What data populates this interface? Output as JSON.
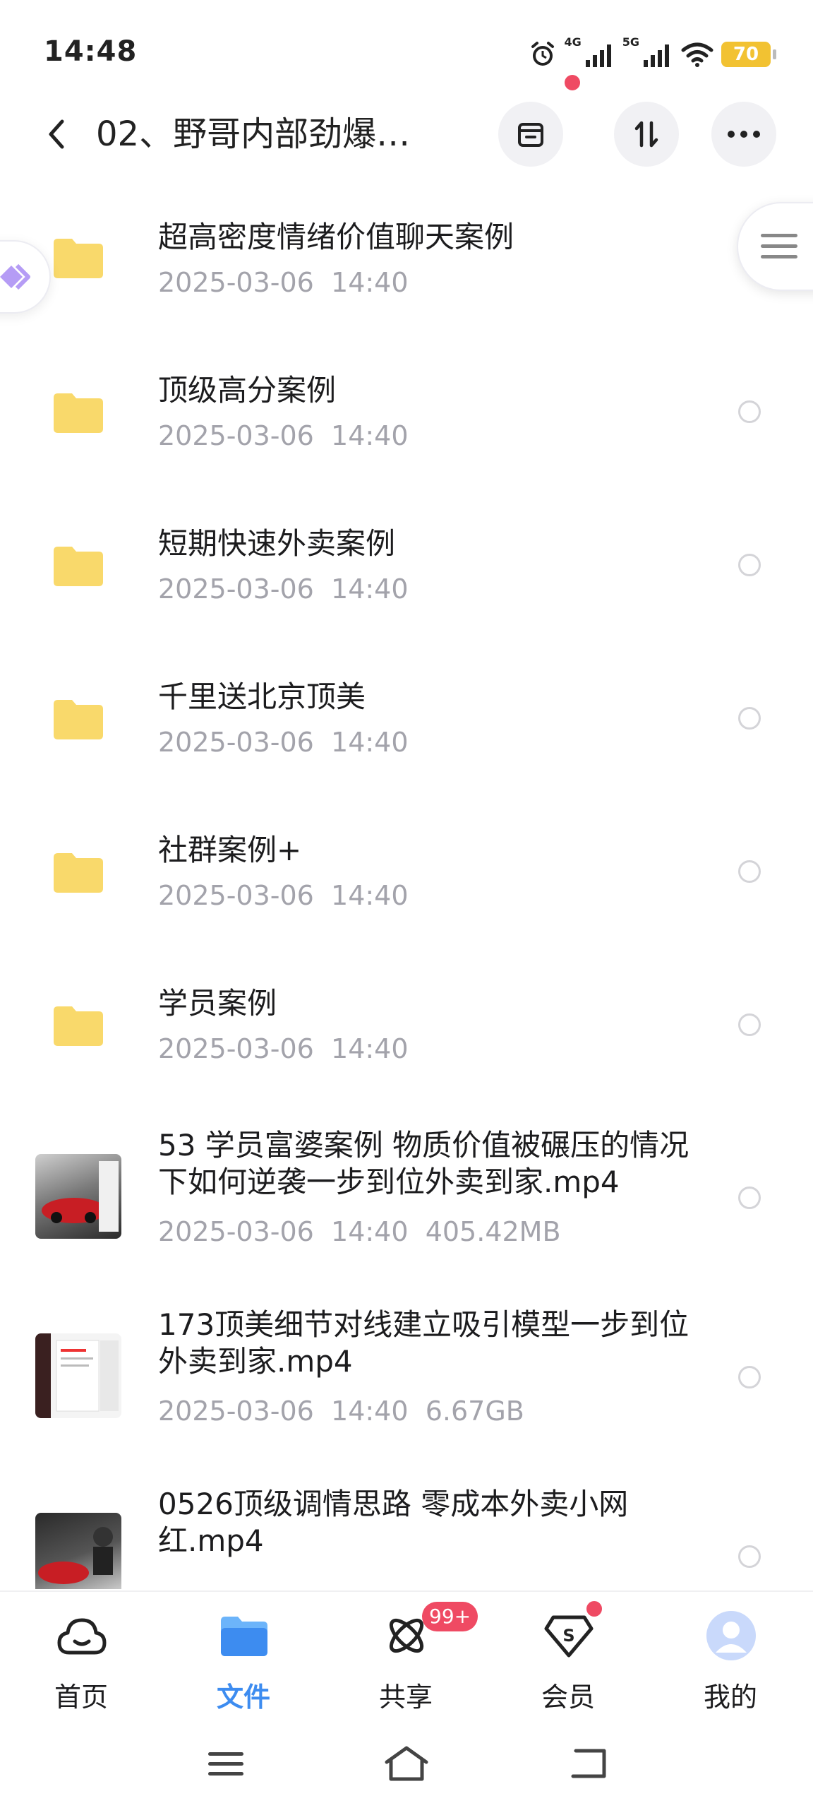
{
  "status_bar": {
    "time": "14:48",
    "network_1": "4G",
    "network_2": "5G",
    "battery": "70"
  },
  "header": {
    "title": "02、野哥内部劲爆…",
    "back_icon": "chevron-left-icon",
    "buttons": [
      "archive-icon",
      "sort-icon",
      "more-icon"
    ]
  },
  "files": [
    {
      "type": "folder",
      "name": "超高密度情绪价值聊天案例",
      "date": "2025-03-06",
      "time": "14:40",
      "size": ""
    },
    {
      "type": "folder",
      "name": "顶级高分案例",
      "date": "2025-03-06",
      "time": "14:40",
      "size": ""
    },
    {
      "type": "folder",
      "name": "短期快速外卖案例",
      "date": "2025-03-06",
      "time": "14:40",
      "size": ""
    },
    {
      "type": "folder",
      "name": "千里送北京顶美",
      "date": "2025-03-06",
      "time": "14:40",
      "size": ""
    },
    {
      "type": "folder",
      "name": "社群案例+",
      "date": "2025-03-06",
      "time": "14:40",
      "size": ""
    },
    {
      "type": "folder",
      "name": "学员案例",
      "date": "2025-03-06",
      "time": "14:40",
      "size": ""
    },
    {
      "type": "video",
      "name": "53 学员富婆案例 物质价值被碾压的情况下如何逆袭一步到位外卖到家.mp4",
      "date": "2025-03-06",
      "time": "14:40",
      "size": "405.42MB"
    },
    {
      "type": "video",
      "name": "173顶美细节对线建立吸引模型一步到位外卖到家.mp4",
      "date": "2025-03-06",
      "time": "14:40",
      "size": "6.67GB"
    },
    {
      "type": "video",
      "name": "0526顶级调情思路 零成本外卖小网红.mp4",
      "date": "",
      "time": "",
      "size": ""
    }
  ],
  "tabs": [
    {
      "label": "首页",
      "icon": "home-cloud-icon",
      "active": false
    },
    {
      "label": "文件",
      "icon": "folder-icon",
      "active": true
    },
    {
      "label": "共享",
      "icon": "share-atom-icon",
      "badge": "99+"
    },
    {
      "label": "会员",
      "icon": "vip-diamond-icon",
      "dot": true
    },
    {
      "label": "我的",
      "icon": "avatar-icon"
    }
  ],
  "colors": {
    "accent": "#3d8cf0",
    "folder": "#f9d96b",
    "badge": "#ef4a63",
    "meta_text": "#a3a3ab"
  }
}
